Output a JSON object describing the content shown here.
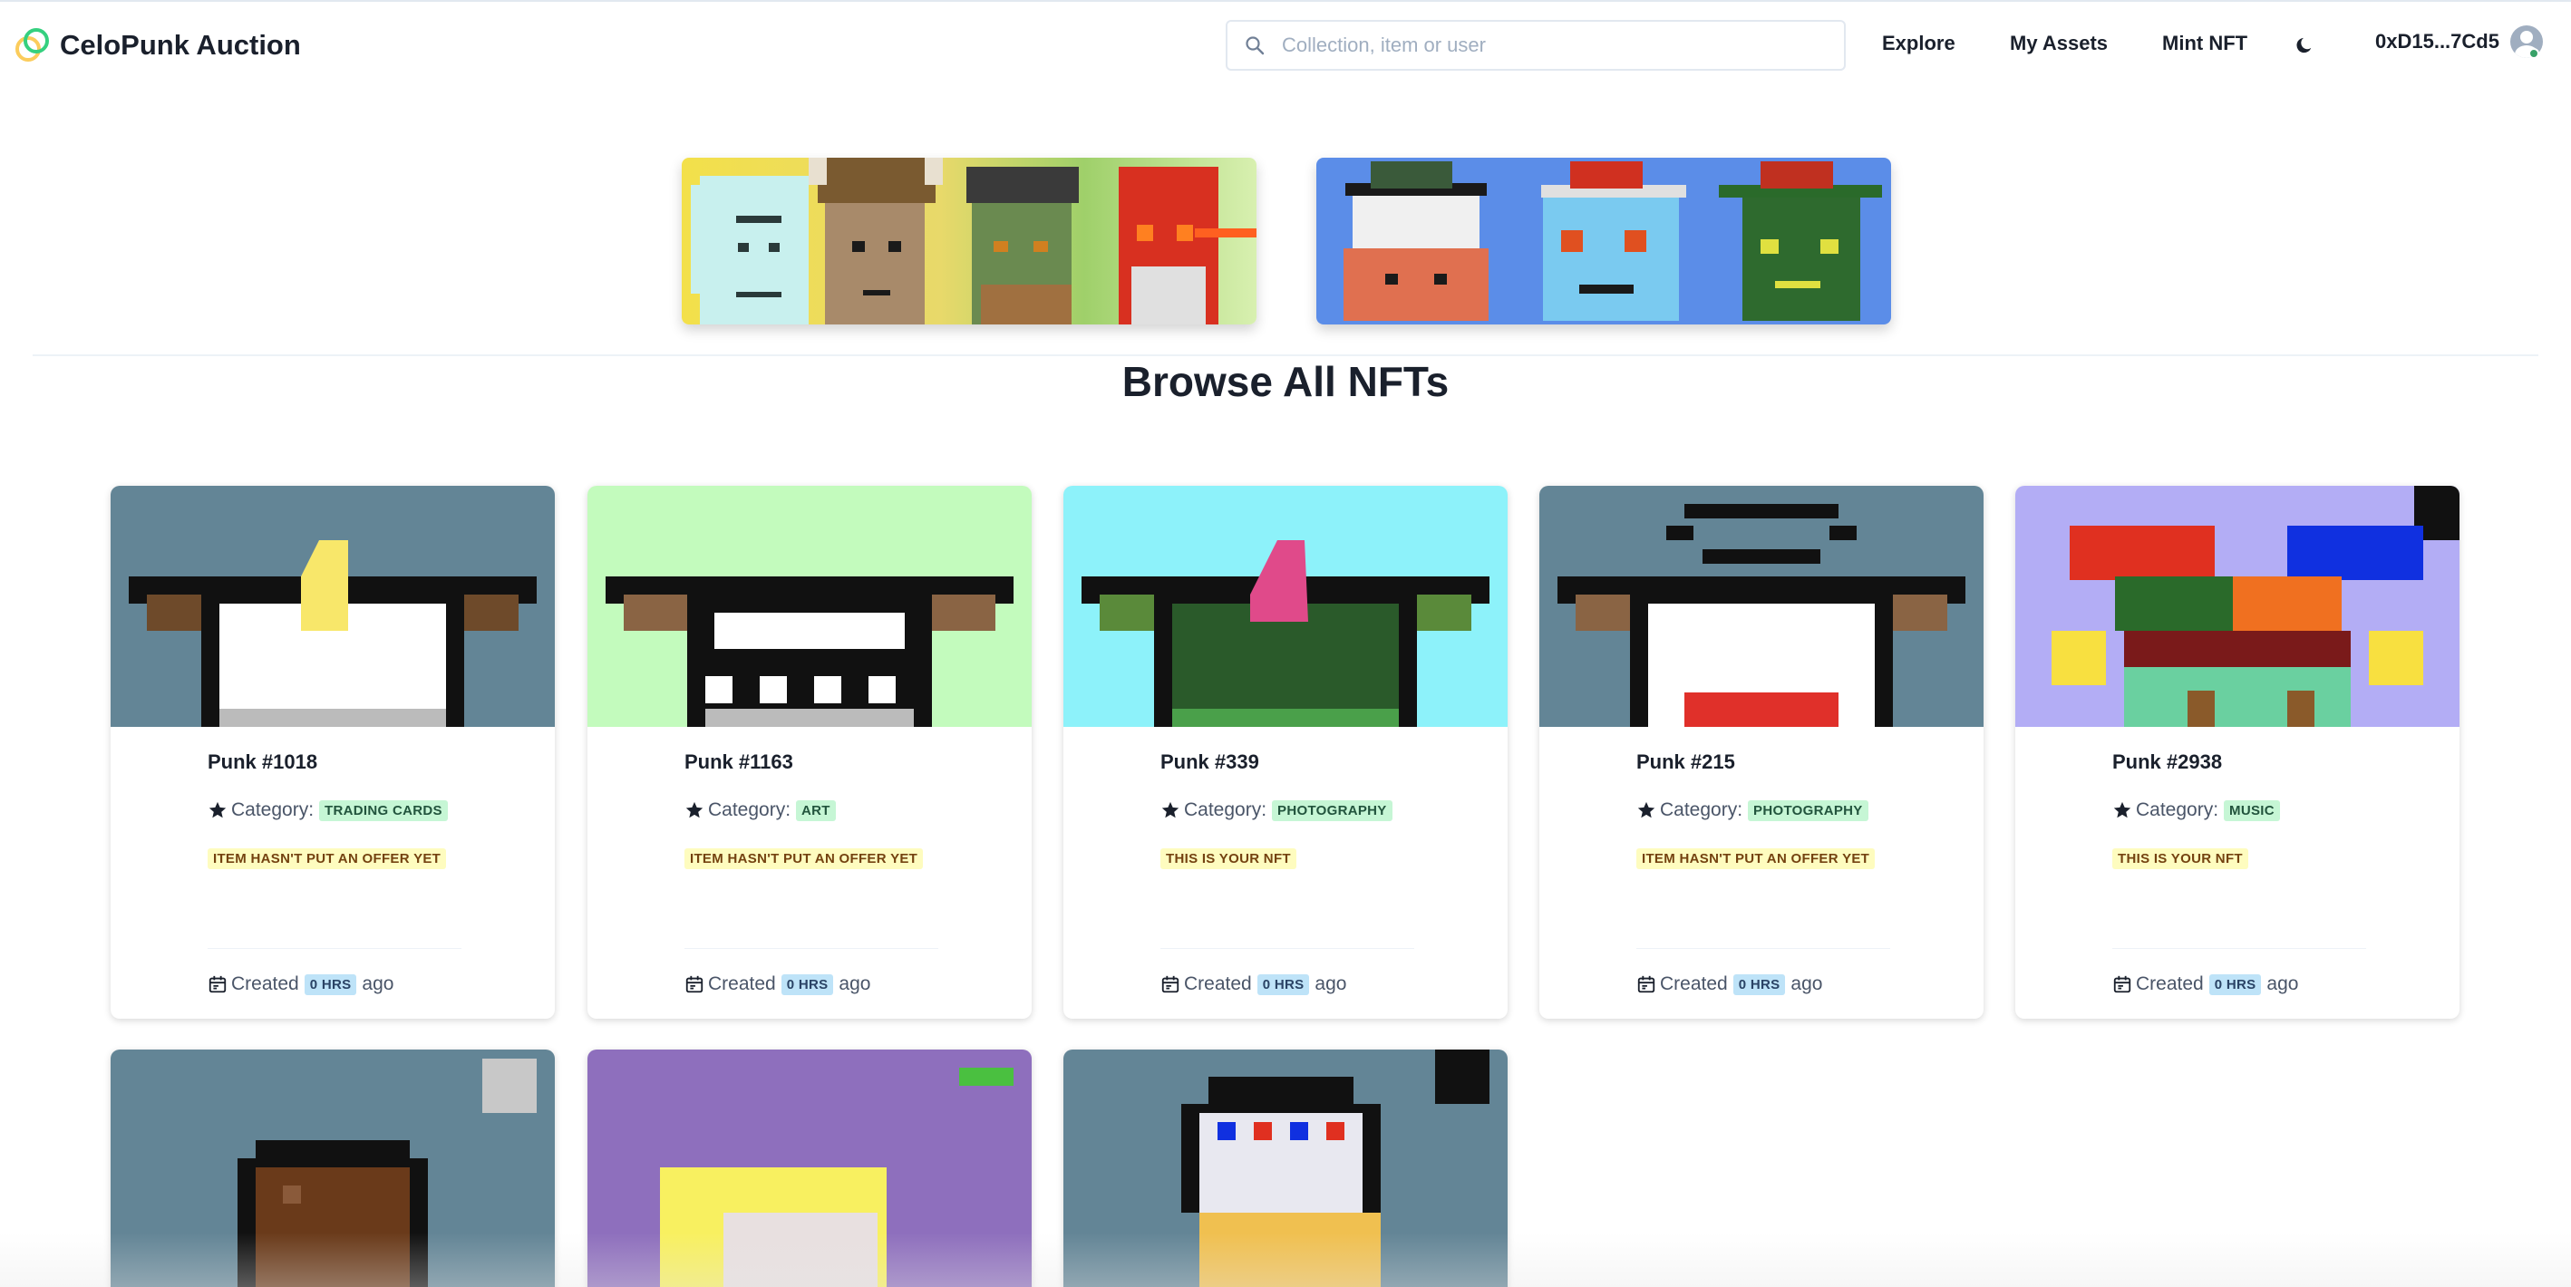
{
  "app": {
    "title": "CeloPunk Auction",
    "brand_colors": {
      "accent_green": "#35D07F",
      "accent_gold": "#FBCC5C"
    }
  },
  "header": {
    "search_placeholder": "Collection, item or user",
    "nav": {
      "explore": "Explore",
      "my_assets": "My Assets",
      "mint_nft": "Mint NFT"
    },
    "theme_icon": "moon-icon",
    "account": "0xD15...7Cd5"
  },
  "main": {
    "title": "Browse All NFTs",
    "category_label": "Category:",
    "created_label": "Created",
    "ago_label": "ago",
    "cards": [
      {
        "name": "Punk #1018",
        "category": "TRADING CARDS",
        "status": "ITEM HASN'T PUT AN OFFER YET",
        "created": "0 HRS",
        "bg": "#638596"
      },
      {
        "name": "Punk #1163",
        "category": "ART",
        "status": "ITEM HASN'T PUT AN OFFER YET",
        "created": "0 HRS",
        "bg": "#c3fbbd"
      },
      {
        "name": "Punk #339",
        "category": "PHOTOGRAPHY",
        "status": "THIS IS YOUR NFT",
        "created": "0 HRS",
        "bg": "#8df2fa"
      },
      {
        "name": "Punk #215",
        "category": "PHOTOGRAPHY",
        "status": "ITEM HASN'T PUT AN OFFER YET",
        "created": "0 HRS",
        "bg": "#638596"
      },
      {
        "name": "Punk #2938",
        "category": "MUSIC",
        "status": "THIS IS YOUR NFT",
        "created": "0 HRS",
        "bg": "#b3adf5"
      },
      {
        "bg": "#638596"
      },
      {
        "bg": "#8e6fbd"
      },
      {
        "bg": "#638596"
      }
    ]
  }
}
